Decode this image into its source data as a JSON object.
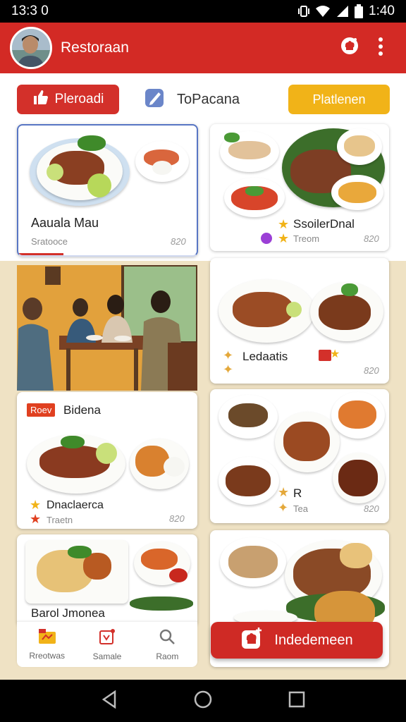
{
  "status": {
    "time": "13:3 0",
    "battery": "1:40"
  },
  "app_bar": {
    "title": "Restoraan"
  },
  "filters": {
    "primary": "Pleroadi",
    "link": "ToPacana",
    "secondary": "Platlenen"
  },
  "cards": [
    {
      "title": "Aauala Mau",
      "subtitle": "Sratooce",
      "price": "820"
    },
    {
      "title": "SsoilerDnal",
      "subtitle": "Treom",
      "price": "820"
    },
    {
      "title": "Ledaatis",
      "price": "820"
    },
    {
      "tag": "Roev",
      "title": "Bidena",
      "subtitle": "Dnaclaerca",
      "meta": "Traetn",
      "price": "820"
    },
    {
      "title": "R",
      "subtitle": "Tea",
      "price": "820"
    },
    {
      "title": "Barol Jmonea"
    }
  ],
  "bottom_nav": [
    {
      "label": "Rreotwas",
      "icon": "list-icon"
    },
    {
      "label": "Samale",
      "icon": "bookmark-icon"
    },
    {
      "label": "Raom",
      "icon": "search-icon"
    }
  ],
  "fab": {
    "label": "Indedemeen",
    "icon": "chef-hat-icon"
  },
  "colors": {
    "primary": "#d32a25",
    "accent": "#f1b318",
    "background": "#efe2c4"
  }
}
